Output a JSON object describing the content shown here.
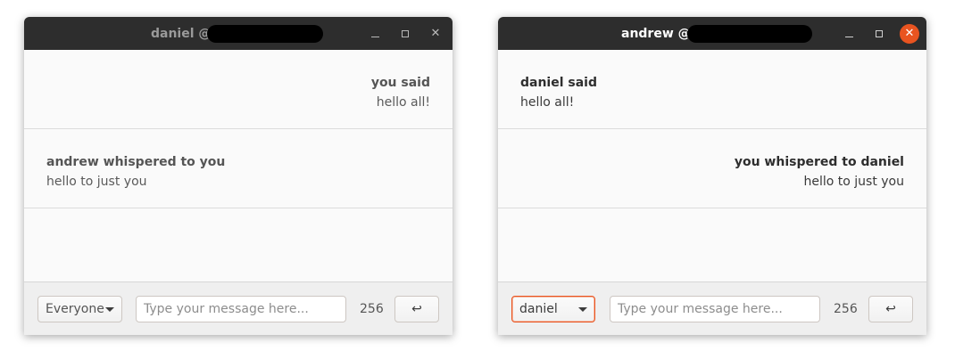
{
  "colors": {
    "titlebar_bg": "#2d2d2d",
    "accent": "#e95420",
    "content_bg": "#fafafa"
  },
  "windows": [
    {
      "title_name": "daniel @",
      "title_redacted": true,
      "controls": {
        "minimize_icon": "minimize-icon",
        "maximize_icon": "maximize-icon",
        "close_icon": "close-icon",
        "close_glyph": "✕"
      },
      "messages": [
        {
          "sender": "you said",
          "text": "hello all!",
          "align": "right"
        },
        {
          "sender": "andrew whispered to you",
          "text": "hello to just you",
          "align": "left"
        }
      ],
      "recipient": {
        "selected": "Everyone"
      },
      "input": {
        "value": "",
        "placeholder": "Type your message here..."
      },
      "char_counter": "256",
      "send": {
        "icon": "return-icon",
        "glyph": "↩"
      }
    },
    {
      "title_name": "andrew @",
      "title_redacted": true,
      "controls": {
        "minimize_icon": "minimize-icon",
        "maximize_icon": "maximize-icon",
        "close_icon": "close-icon",
        "close_glyph": "✕"
      },
      "messages": [
        {
          "sender": "daniel said",
          "text": "hello all!",
          "align": "left"
        },
        {
          "sender": "you whispered to daniel",
          "text": "hello to just you",
          "align": "right"
        }
      ],
      "recipient": {
        "selected": "daniel"
      },
      "input": {
        "value": "",
        "placeholder": "Type your message here..."
      },
      "char_counter": "256",
      "send": {
        "icon": "return-icon",
        "glyph": "↩"
      }
    }
  ]
}
